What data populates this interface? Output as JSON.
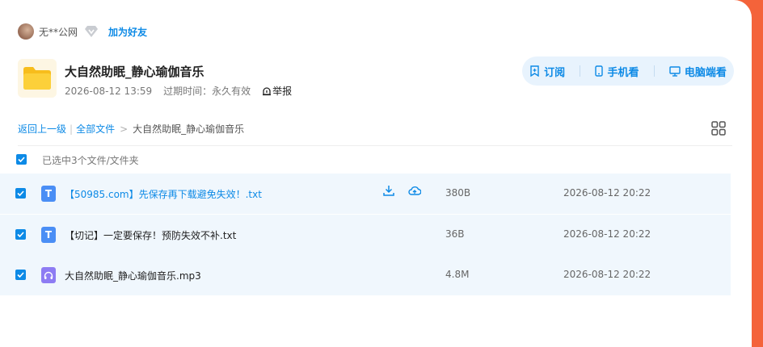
{
  "user": {
    "name": "无**公网",
    "add_friend": "加为好友"
  },
  "share": {
    "title": "大自然助眠_静心瑜伽音乐",
    "date": "2026-08-12 13:59",
    "expiry": "过期时间：永久有效",
    "report": "举报"
  },
  "actions": {
    "subscribe": "订阅",
    "mobile": "手机看",
    "pc": "电脑端看"
  },
  "breadcrumb": {
    "back": "返回上一级",
    "all": "全部文件",
    "sep": ">",
    "current": "大自然助眠_静心瑜伽音乐"
  },
  "selection": {
    "label": "已选中3个文件/文件夹"
  },
  "files": [
    {
      "name": "【50985.com】先保存再下载避免失效！.txt",
      "size": "380B",
      "date": "2026-08-12 20:22",
      "icon": "text-file-icon"
    },
    {
      "name": "【切记】一定要保存！预防失效不补.txt",
      "size": "36B",
      "date": "2026-08-12 20:22",
      "icon": "text-file-icon"
    },
    {
      "name": "大自然助眠_静心瑜伽音乐.mp3",
      "size": "4.8M",
      "date": "2026-08-12 20:22",
      "icon": "audio-file-icon"
    }
  ],
  "colors": {
    "accent": "#0d8ae6",
    "background": "#f4633a",
    "row_highlight": "#f0f7fd",
    "text_icon": "#4a8ef5",
    "audio_icon": "#8d7cf3",
    "folder": "#f7bd1c"
  }
}
